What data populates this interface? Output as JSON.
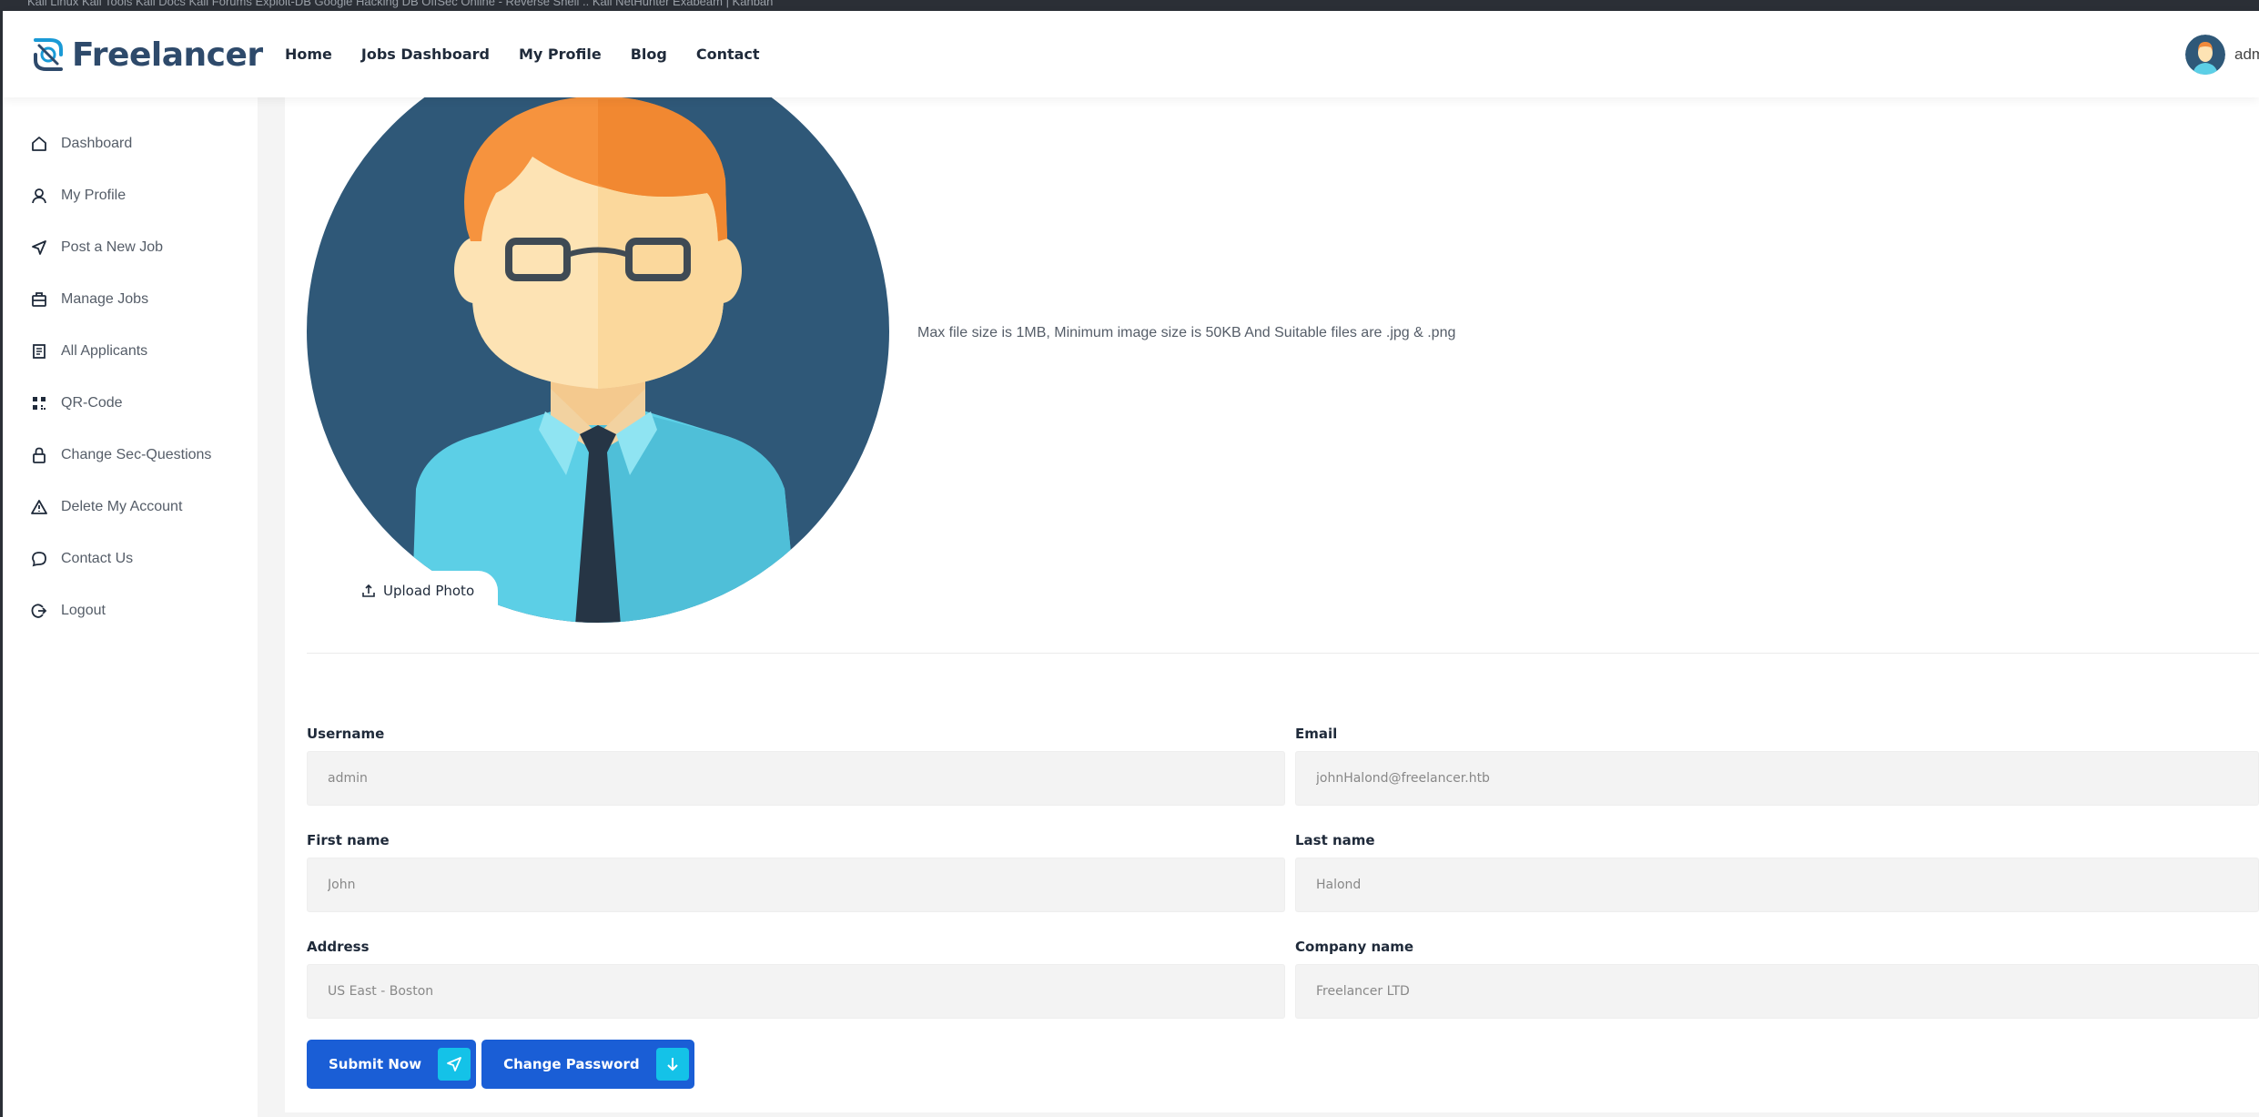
{
  "browser": {
    "bookmarks_text": "Kali Linux  Kali Tools  Kali Docs  Kali Forums  Exploit-DB  Google Hacking DB  OffSec  Online - Reverse Shell ..  Kali NetHunter  Exabeam | Kanban"
  },
  "header": {
    "logo_text": "Freelancer",
    "nav": [
      {
        "label": "Home"
      },
      {
        "label": "Jobs Dashboard"
      },
      {
        "label": "My Profile"
      },
      {
        "label": "Blog"
      },
      {
        "label": "Contact"
      }
    ],
    "user_name": "adm"
  },
  "sidebar": {
    "items": [
      {
        "label": "Dashboard",
        "icon": "home-icon"
      },
      {
        "label": "My Profile",
        "icon": "user-icon"
      },
      {
        "label": "Post a New Job",
        "icon": "send-icon"
      },
      {
        "label": "Manage Jobs",
        "icon": "briefcase-icon"
      },
      {
        "label": "All Applicants",
        "icon": "document-icon"
      },
      {
        "label": "QR-Code",
        "icon": "qr-code-icon"
      },
      {
        "label": "Change Sec-Questions",
        "icon": "lock-icon"
      },
      {
        "label": "Delete My Account",
        "icon": "warning-icon"
      },
      {
        "label": "Contact Us",
        "icon": "chat-bubble-icon"
      },
      {
        "label": "Logout",
        "icon": "logout-icon"
      }
    ]
  },
  "profile": {
    "upload_label": "Upload Photo",
    "file_note": "Max file size is 1MB, Minimum image size is 50KB And Suitable files are .jpg & .png"
  },
  "form": {
    "username": {
      "label": "Username",
      "value": "admin"
    },
    "email": {
      "label": "Email",
      "value": "johnHalond@freelancer.htb"
    },
    "first_name": {
      "label": "First name",
      "value": "John"
    },
    "last_name": {
      "label": "Last name",
      "value": "Halond"
    },
    "address": {
      "label": "Address",
      "value": "US East - Boston"
    },
    "company": {
      "label": "Company name",
      "value": "Freelancer LTD"
    }
  },
  "buttons": {
    "submit_label": "Submit Now",
    "change_password_label": "Change Password"
  },
  "colors": {
    "primary": "#1a5ed6",
    "accent": "#14c2e8",
    "avatar_bg": "#2f5878"
  }
}
